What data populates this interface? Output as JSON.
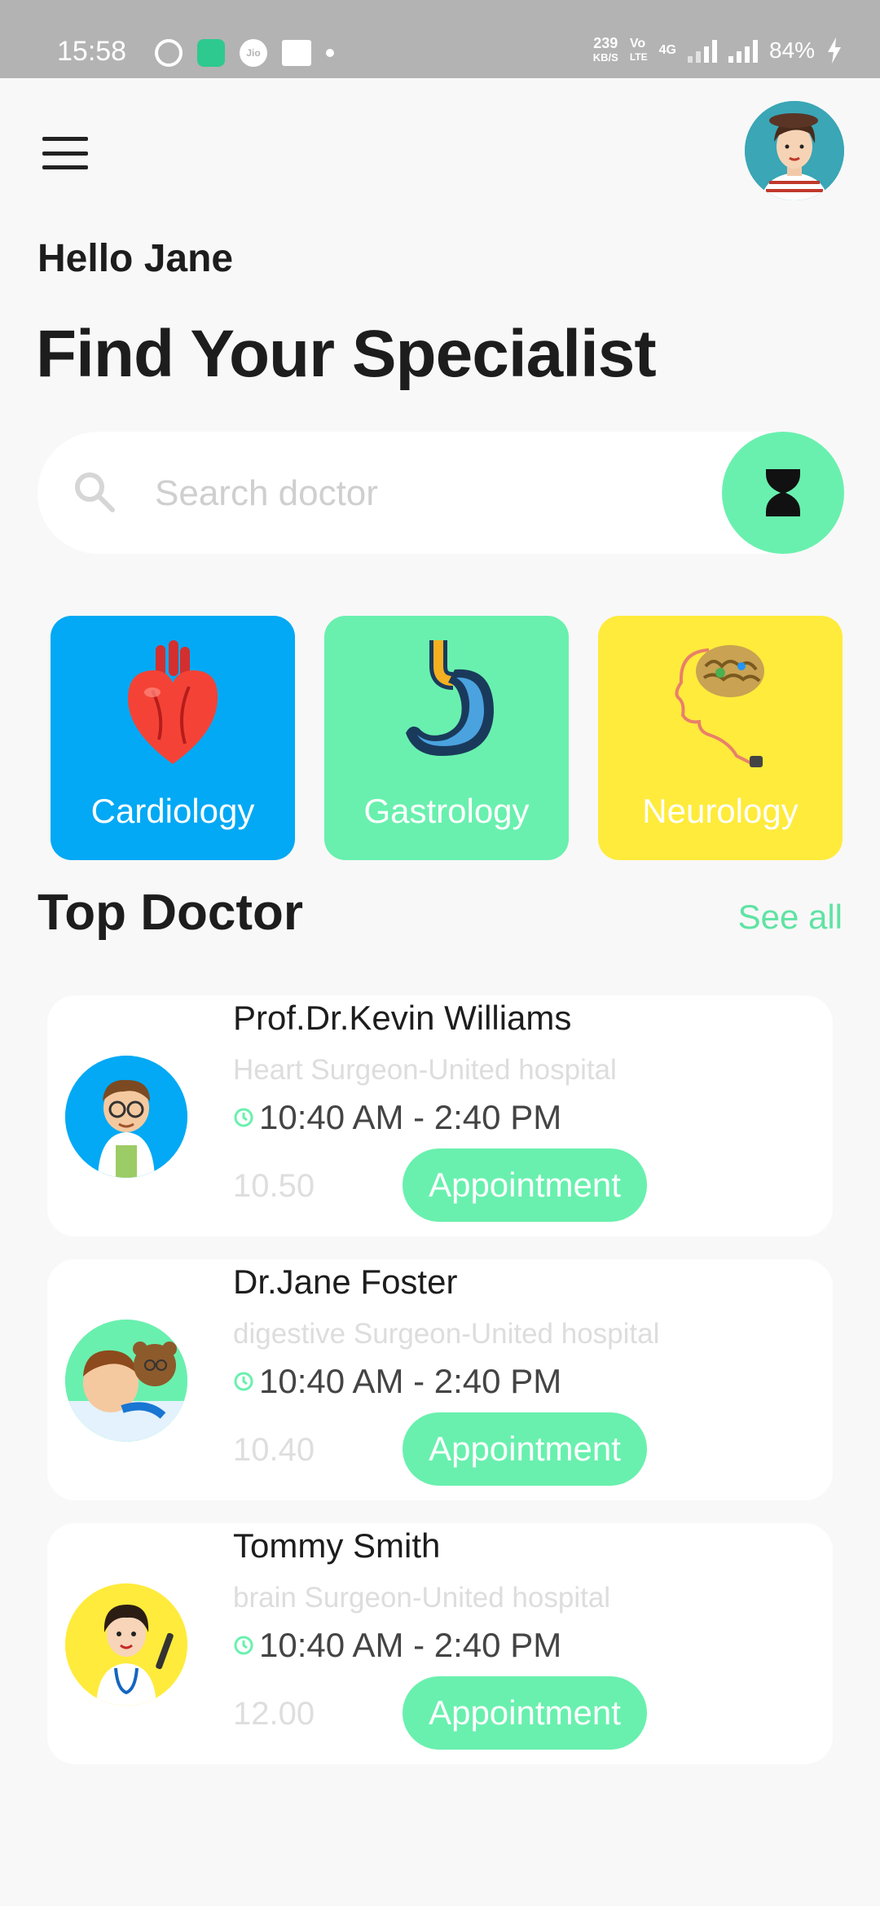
{
  "status_bar": {
    "time": "15:58",
    "speed_value": "239",
    "speed_unit": "KB/S",
    "volte_top": "Vo",
    "volte_bottom": "LTE",
    "network": "4G",
    "battery": "84%"
  },
  "header": {
    "greeting": "Hello Jane",
    "title": "Find Your Specialist"
  },
  "search": {
    "placeholder": "Search doctor"
  },
  "categories": [
    {
      "label": "Cardiology",
      "color": "#03a9f4",
      "icon": "heart-icon"
    },
    {
      "label": "Gastrology",
      "color": "#69f0ae",
      "icon": "stomach-icon"
    },
    {
      "label": "Neurology",
      "color": "#ffeb3b",
      "icon": "brain-icon"
    }
  ],
  "top_doctor": {
    "heading": "Top Doctor",
    "see_all": "See all"
  },
  "doctors": [
    {
      "name": "Prof.Dr.Kevin Williams",
      "specialty": "Heart Surgeon-United hospital",
      "hours": "10:40 AM - 2:40 PM",
      "price": "10.50",
      "button": "Appointment",
      "avatar_bg": "#03a9f4"
    },
    {
      "name": "Dr.Jane Foster",
      "specialty": "digestive Surgeon-United hospital",
      "hours": "10:40 AM - 2:40 PM",
      "price": "10.40",
      "button": "Appointment",
      "avatar_bg": "#69f0ae"
    },
    {
      "name": "Tommy Smith",
      "specialty": "brain Surgeon-United hospital",
      "hours": "10:40 AM - 2:40 PM",
      "price": "12.00",
      "button": "Appointment",
      "avatar_bg": "#ffeb3b"
    }
  ],
  "accent_color": "#69f0ae"
}
